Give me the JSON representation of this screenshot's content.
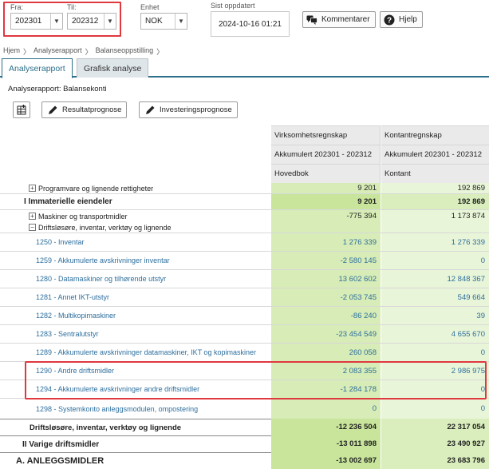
{
  "filters": {
    "from_label": "Fra:",
    "from_value": "202301",
    "to_label": "Til:",
    "to_value": "202312",
    "unit_label": "Enhet",
    "unit_value": "NOK",
    "updated_label": "Sist oppdatert",
    "updated_value": "2024-10-16 01:21",
    "comments_label": "Kommentarer",
    "help_label": "Hjelp"
  },
  "breadcrumb": [
    "Hjem",
    "Analyserapport",
    "Balanseoppstilling"
  ],
  "breadcrumb_sep": "〉",
  "tabs": [
    "Analyserapport",
    "Grafisk analyse"
  ],
  "report_title": "Analyserapport: Balansekonti",
  "toolbar": {
    "result_forecast": "Resultatprognose",
    "investment_forecast": "Investeringsprognose"
  },
  "columns": [
    {
      "title": "Virksomhetsregnskap",
      "period": "Akkumulert 202301 - 202312",
      "sub": "Hovedbok"
    },
    {
      "title": "Kontantregnskap",
      "period": "Akkumulert 202301 - 202312",
      "sub": "Kontant"
    }
  ],
  "rows": [
    {
      "label": "Programvare og lignende rettigheter",
      "a": "9 201",
      "b": "192 869",
      "tree": "+"
    },
    {
      "label": "I Immaterielle eiendeler",
      "a": "9 201",
      "b": "192 869"
    },
    {
      "label": "Maskiner og transportmidler",
      "a": "-775 394",
      "b": "1 173 874",
      "tree": "+"
    },
    {
      "label": "Driftsløsøre, inventar, verktøy og lignende",
      "a": "",
      "b": "",
      "tree": "−"
    },
    {
      "label": "1250 - Inventar",
      "a": "1 276 339",
      "b": "1 276 339"
    },
    {
      "label": "1259 - Akkumulerte avskrivninger inventar",
      "a": "-2 580 145",
      "b": "0"
    },
    {
      "label": "1280 - Datamaskiner og tilhørende utstyr",
      "a": "13 602 602",
      "b": "12 848 367"
    },
    {
      "label": "1281 - Annet IKT-utstyr",
      "a": "-2 053 745",
      "b": "549 664"
    },
    {
      "label": "1282 - Multikopimaskiner",
      "a": "-86 240",
      "b": "39"
    },
    {
      "label": "1283 - Sentralutstyr",
      "a": "-23 454 549",
      "b": "4 655 670"
    },
    {
      "label": "1289 - Akkumulerte avskrivninger datamaskiner, IKT og kopimaskiner",
      "a": "260 058",
      "b": "0"
    },
    {
      "label": "1290 - Andre driftsmidler",
      "a": "2 083 355",
      "b": "2 986 975"
    },
    {
      "label": "1294 - Akkumulerte avskrivninger andre driftsmidler",
      "a": "-1 284 178",
      "b": "0"
    },
    {
      "label": "1298 - Systemkonto anleggsmodulen, ompostering",
      "a": "0",
      "b": "0"
    },
    {
      "label": "Driftsløsøre, inventar, verktøy og lignende",
      "a": "-12 236 504",
      "b": "22 317 054"
    },
    {
      "label": "II Varige driftsmidler",
      "a": "-13 011 898",
      "b": "23 490 927"
    },
    {
      "label": "A. ANLEGGSMIDLER",
      "a": "-13 002 697",
      "b": "23 683 796"
    }
  ]
}
